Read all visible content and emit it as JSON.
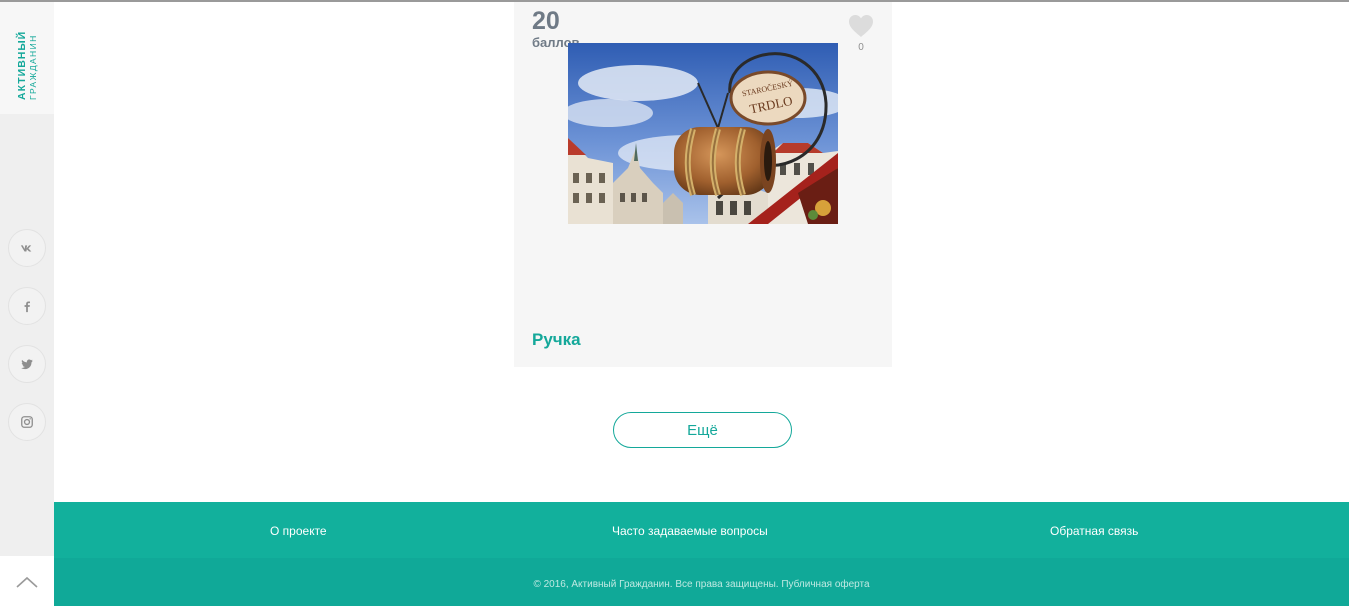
{
  "sidebar": {
    "logo_line1": "АКТИВНЫЙ",
    "logo_line2": "ГРАЖДАНИН",
    "social": [
      {
        "icon": "vk-icon"
      },
      {
        "icon": "facebook-icon"
      },
      {
        "icon": "twitter-icon"
      },
      {
        "icon": "instagram-icon"
      }
    ],
    "scroll_up_icon": "chevron-up-icon"
  },
  "card": {
    "score": "20",
    "score_label": "баллов",
    "like_count": "0",
    "photo_sign_text_1": "STAROČESKÝ",
    "photo_sign_text_2": "TRDLO",
    "title": "Ручка"
  },
  "more_button": "Ещё",
  "footer": {
    "links": [
      "О проекте",
      "Часто задаваемые вопросы",
      "Обратная связь"
    ],
    "copyright": "© 2016, Активный Гражданин. Все права защищены. Публичная оферта"
  },
  "colors": {
    "accent": "#14a89a",
    "footer": "#12b09c",
    "score": "#6f7a86"
  }
}
